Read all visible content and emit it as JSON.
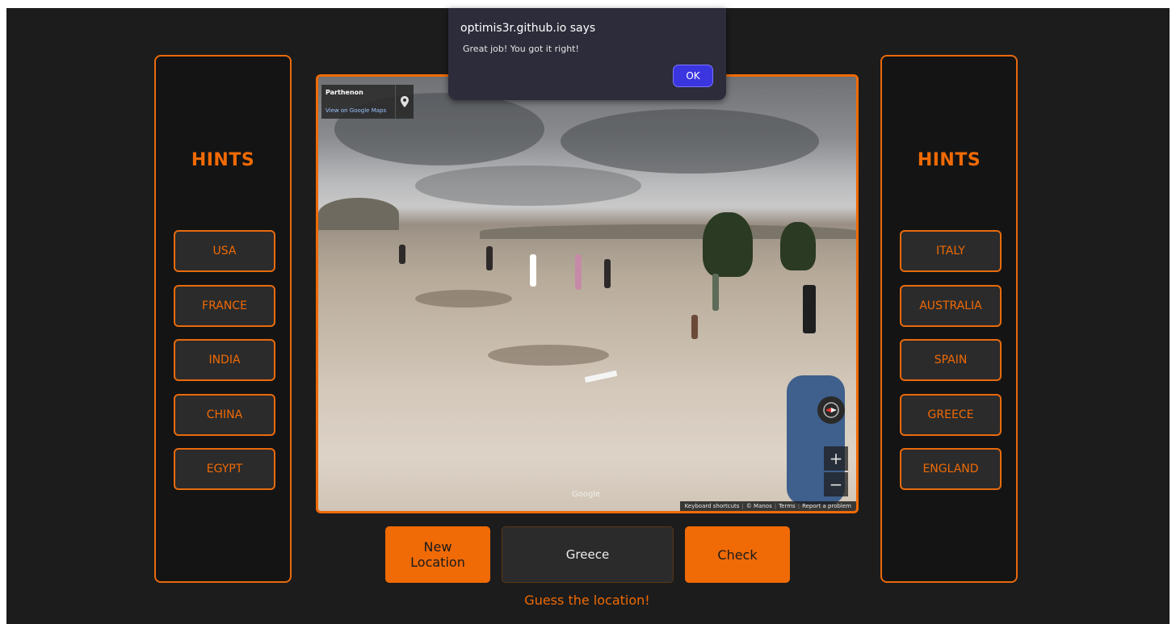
{
  "left_panel": {
    "title": "HINTS",
    "hints": [
      "USA",
      "FRANCE",
      "INDIA",
      "CHINA",
      "EGYPT"
    ]
  },
  "right_panel": {
    "title": "HINTS",
    "hints": [
      "ITALY",
      "AUSTRALIA",
      "SPAIN",
      "GREECE",
      "ENGLAND"
    ]
  },
  "streetview": {
    "place_name": "Parthenon",
    "maps_link": "View on Google Maps",
    "zoom_in": "+",
    "zoom_out": "−",
    "watermark": "Google",
    "attribution": [
      "Keyboard shortcuts",
      "© Manos",
      "Terms",
      "Report a problem"
    ]
  },
  "controls": {
    "new_location_line1": "New",
    "new_location_line2": "Location",
    "guess_value": "Greece",
    "check_label": "Check",
    "status": "Guess the location!"
  },
  "alert": {
    "title": "optimis3r.github.io says",
    "message": "Great job! You got it right!",
    "ok_label": "OK"
  },
  "colors": {
    "accent": "#f06a05",
    "background": "#1c1c1c",
    "panel": "#141414",
    "dialog": "#2c2c3a",
    "ok_button": "#3b35e0"
  }
}
